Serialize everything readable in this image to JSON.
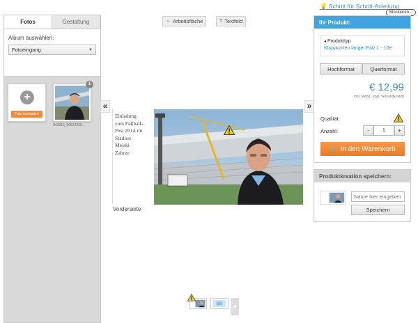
{
  "left_panel": {
    "tabs": [
      {
        "label": "Fotos",
        "active": true
      },
      {
        "label": "Gestaltung",
        "active": false
      }
    ],
    "album_label": "Album auswählen:",
    "album_selected": "Fotoeingang",
    "upload_label": "Foto hochladen",
    "photo_count": "1",
    "photo_name": "943316_56634265..."
  },
  "toolbar": {
    "workspace_label": "Arbeitsfläche",
    "textfield_label": "Textfeld"
  },
  "card": {
    "text_lines": [
      "Einladung",
      "zum Fußball-",
      "Fest 2014 im",
      "Stadion",
      "Mejski",
      "Zabrze"
    ],
    "front_label": "Vorderseite"
  },
  "right_panel": {
    "guide_link": "Schritt für Schritt-Anleitung",
    "blocker_badge": "Blockieren...",
    "product_header": "Ihr Produkt:",
    "product_type_label": "Produkttyp",
    "product_type_value": "Klappkarten langer Falz L - 10e",
    "formats": [
      {
        "label": "Hochformat",
        "active": false
      },
      {
        "label": "Querformat",
        "active": true
      }
    ],
    "price": "€ 12,99",
    "vat_note": "inkl. MwSt., zzgl. Versandkosten",
    "quality_label": "Qualität:",
    "quantity_label": "Anzahl:",
    "quantity_value": "1",
    "minus": "-",
    "plus": "+",
    "cart_button": "In den Warenkorb",
    "save_header": "Produktkreation speichern:",
    "name_placeholder": "Name hier eingeben",
    "save_button": "Speichern"
  },
  "colors": {
    "accent_blue": "#3fa4e0",
    "cart_orange": "#ec7a22",
    "warning_yellow": "#f5d020"
  }
}
